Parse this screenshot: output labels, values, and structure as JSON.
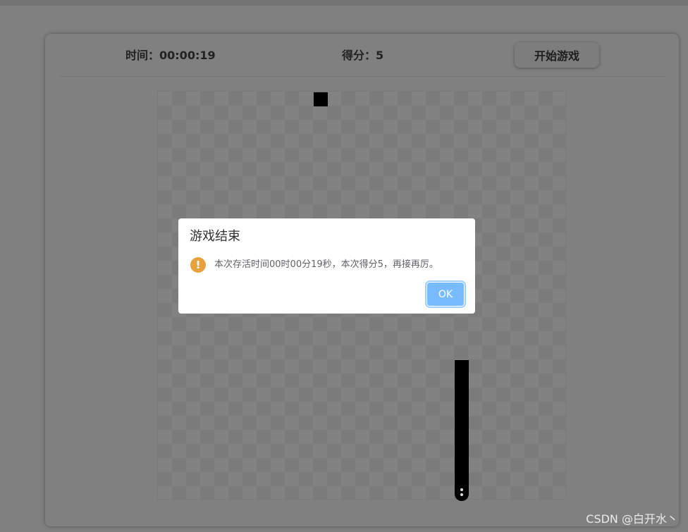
{
  "header": {
    "time_label": "时间：",
    "time_value": "00:00:19",
    "score_label": "得分：",
    "score_value": "5",
    "start_button": "开始游戏"
  },
  "dialog": {
    "title": "游戏结束",
    "icon": "warning-icon",
    "message": "本次存活时间00时00分19秒，本次得分5，再接再厉。",
    "ok_button": "OK"
  },
  "watermark": "CSDN @白开水丶",
  "colors": {
    "overlay": "#808080",
    "warning": "#e6a23c",
    "ok_button": "#79bbff",
    "snake": "#000000",
    "food": "#000000"
  }
}
